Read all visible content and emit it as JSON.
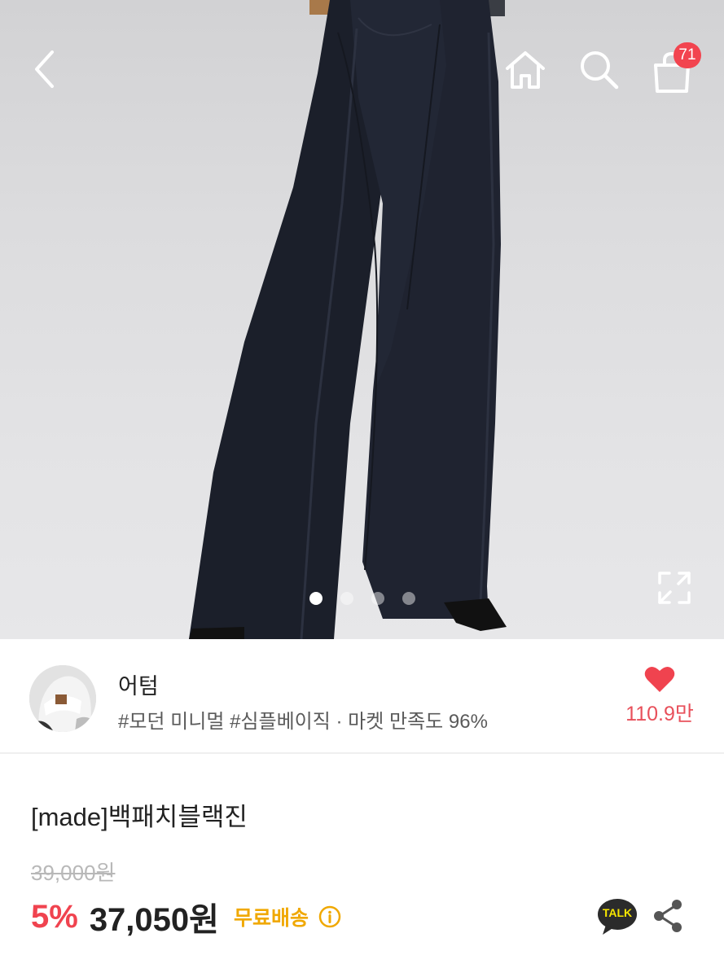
{
  "header": {
    "icons": [
      "back-icon",
      "home-icon",
      "search-icon",
      "shopping-bag-icon"
    ],
    "cart_count": "71"
  },
  "gallery": {
    "total_slides": 4,
    "active_slide": 1,
    "expand_icon": "expand-icon"
  },
  "seller": {
    "name": "어텀",
    "tags": "#모던 미니멀 #심플베이직 · 마켓 만족도 96%",
    "like_count": "110.9만",
    "like_icon": "heart-icon"
  },
  "product": {
    "title": "[made]백패치블랙진",
    "original_price": "39,000원",
    "discount": "5%",
    "price": "37,050원",
    "shipping": "무료배송",
    "talk_label": "TALK"
  },
  "colors": {
    "accent_red": "#f0434f",
    "shipping_yellow": "#f0a800",
    "badge_red": "#f2444f"
  }
}
